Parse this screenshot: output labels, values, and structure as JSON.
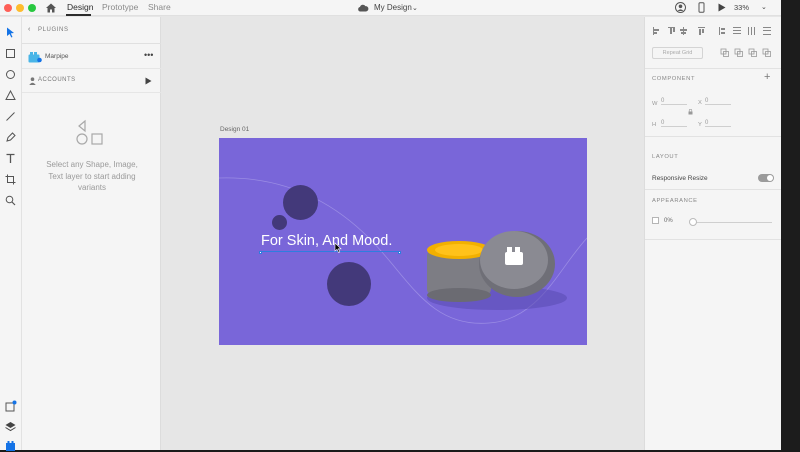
{
  "topbar": {
    "tabs": [
      {
        "label": "Design"
      },
      {
        "label": "Prototype"
      },
      {
        "label": "Share"
      }
    ],
    "doc_title": "My Design",
    "zoom": "33%"
  },
  "plugins_panel": {
    "title": "PLUGINS",
    "plugin_name": "Marpipe",
    "accounts_label": "ACCOUNTS",
    "empty_message": "Select any Shape, Image, Text layer to start adding variants"
  },
  "canvas": {
    "artboard_label": "Design 01",
    "headline": "For Skin, And Mood.",
    "colors": {
      "artboard": "#7966d9",
      "circles": "#43397a",
      "selection": "#2d7de0"
    }
  },
  "properties": {
    "repeat_grid": "Repeat Grid",
    "component_title": "COMPONENT",
    "w_label": "W",
    "w_value": "0",
    "x_label": "X",
    "x_value": "0",
    "h_label": "H",
    "h_value": "0",
    "y_label": "Y",
    "y_value": "0",
    "layout_title": "LAYOUT",
    "responsive_resize": "Responsive Resize",
    "appearance_title": "APPEARANCE",
    "opacity_value": "0%"
  }
}
